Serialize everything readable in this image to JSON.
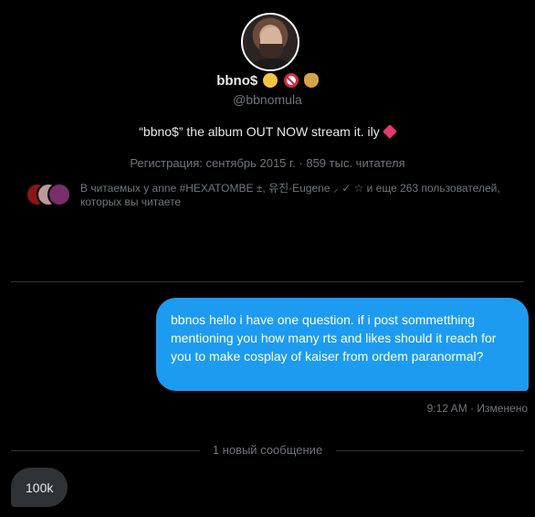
{
  "profile": {
    "name": "bbno$",
    "name_emoji_icons": [
      "baby-face-emoji",
      "no-entry-sign-emoji",
      "money-bag-emoji"
    ],
    "handle": "@bbnomula",
    "bio": "“bbno$” the album OUT NOW stream it. ily",
    "bio_emoji_icon": "sparkling-heart-emoji",
    "meta": "Регистрация: сентябрь 2015 г. · 859 тыс. читателя",
    "followed_by": "В читаемых у anne #HEXATOMBE ±, 유진·Eugene ⸝ ✓ ☆ и еще 263 пользователей, которых вы читаете"
  },
  "messages": [
    {
      "direction": "outgoing",
      "text": "bbnos hello i have one question. if i post sommetthing mentioning you how many rts and likes should it reach for you to make cosplay of kaiser from ordem paranormal?",
      "stamp": "9:12 AM · Изменено"
    }
  ],
  "new_messages_divider": "1 новый сообщение",
  "incoming": [
    {
      "direction": "incoming",
      "text": "100k"
    }
  ],
  "colors": {
    "background": "#000000",
    "outgoing_bubble": "#1d9bf0",
    "incoming_bubble": "#2f3336",
    "muted_text": "#71767b",
    "divider": "#2f3336"
  }
}
